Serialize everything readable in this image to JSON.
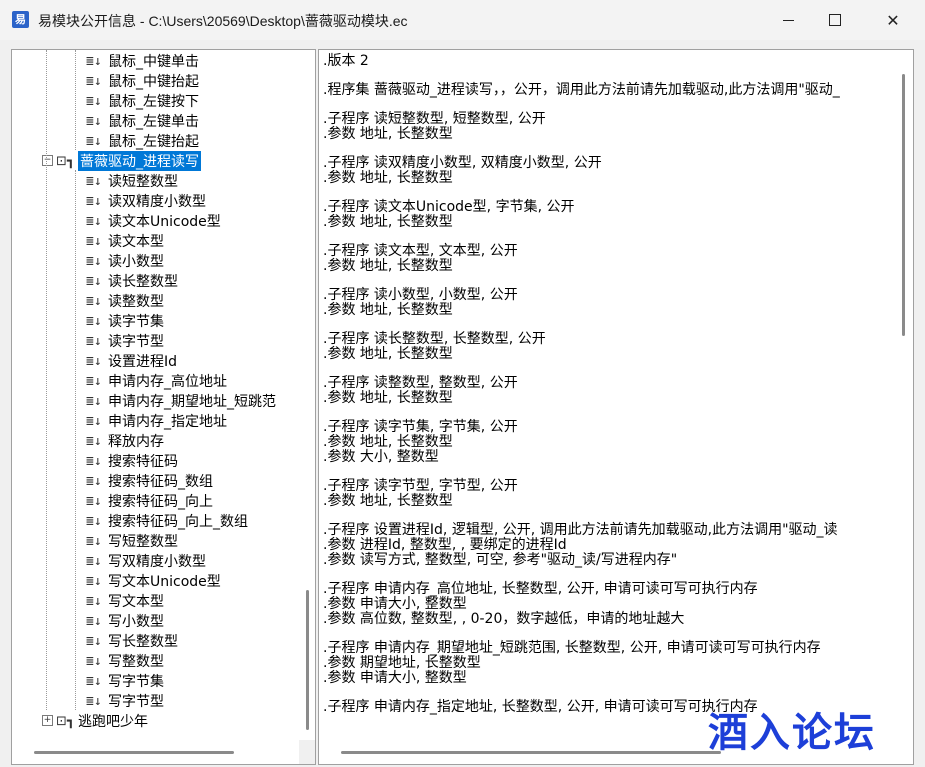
{
  "window": {
    "title": "易模块公开信息 - C:\\Users\\20569\\Desktop\\蔷薇驱动模块.ec",
    "app_icon_text": "易",
    "controls": {
      "minimize": "minimize-icon",
      "maximize": "maximize-icon",
      "close": "✕"
    }
  },
  "tree": {
    "items": [
      {
        "label": "鼠标_中键单击",
        "level": 2
      },
      {
        "label": "鼠标_中键抬起",
        "level": 2
      },
      {
        "label": "鼠标_左键按下",
        "level": 2
      },
      {
        "label": "鼠标_左键单击",
        "level": 2
      },
      {
        "label": "鼠标_左键抬起",
        "level": 2
      },
      {
        "label": "蔷薇驱动_进程读写",
        "level": 1,
        "expander": "−",
        "selected": true
      },
      {
        "label": "读短整数型",
        "level": 2
      },
      {
        "label": "读双精度小数型",
        "level": 2
      },
      {
        "label": "读文本Unicode型",
        "level": 2
      },
      {
        "label": "读文本型",
        "level": 2
      },
      {
        "label": "读小数型",
        "level": 2
      },
      {
        "label": "读长整数型",
        "level": 2
      },
      {
        "label": "读整数型",
        "level": 2
      },
      {
        "label": "读字节集",
        "level": 2
      },
      {
        "label": "读字节型",
        "level": 2
      },
      {
        "label": "设置进程Id",
        "level": 2
      },
      {
        "label": "申请内存_高位地址",
        "level": 2
      },
      {
        "label": "申请内存_期望地址_短跳范",
        "level": 2
      },
      {
        "label": "申请内存_指定地址",
        "level": 2
      },
      {
        "label": "释放内存",
        "level": 2
      },
      {
        "label": "搜索特征码",
        "level": 2
      },
      {
        "label": "搜索特征码_数组",
        "level": 2
      },
      {
        "label": "搜索特征码_向上",
        "level": 2
      },
      {
        "label": "搜索特征码_向上_数组",
        "level": 2
      },
      {
        "label": "写短整数型",
        "level": 2
      },
      {
        "label": "写双精度小数型",
        "level": 2
      },
      {
        "label": "写文本Unicode型",
        "level": 2
      },
      {
        "label": "写文本型",
        "level": 2
      },
      {
        "label": "写小数型",
        "level": 2
      },
      {
        "label": "写长整数型",
        "level": 2
      },
      {
        "label": "写整数型",
        "level": 2
      },
      {
        "label": "写字节集",
        "level": 2
      },
      {
        "label": "写字节型",
        "level": 2
      },
      {
        "label": "逃跑吧少年",
        "level": 1,
        "expander": "+"
      }
    ]
  },
  "text": {
    "lines": [
      ".版本 2",
      "",
      ".程序集 蔷薇驱动_进程读写，，公开，调用此方法前请先加载驱动,此方法调用\"驱动_",
      "",
      ".子程序 读短整数型, 短整数型, 公开",
      ".参数 地址, 长整数型",
      "",
      ".子程序 读双精度小数型, 双精度小数型, 公开",
      ".参数 地址, 长整数型",
      "",
      ".子程序 读文本Unicode型, 字节集, 公开",
      ".参数 地址, 长整数型",
      "",
      ".子程序 读文本型, 文本型, 公开",
      ".参数 地址, 长整数型",
      "",
      ".子程序 读小数型, 小数型, 公开",
      ".参数 地址, 长整数型",
      "",
      ".子程序 读长整数型, 长整数型, 公开",
      ".参数 地址, 长整数型",
      "",
      ".子程序 读整数型, 整数型, 公开",
      ".参数 地址, 长整数型",
      "",
      ".子程序 读字节集, 字节集, 公开",
      ".参数 地址, 长整数型",
      ".参数 大小, 整数型",
      "",
      ".子程序 读字节型, 字节型, 公开",
      ".参数 地址, 长整数型",
      "",
      ".子程序 设置进程Id, 逻辑型, 公开, 调用此方法前请先加载驱动,此方法调用\"驱动_读",
      ".参数 进程Id, 整数型, , 要绑定的进程Id",
      ".参数 读写方式, 整数型, 可空, 参考\"驱动_读/写进程内存\"",
      "",
      ".子程序 申请内存_高位地址, 长整数型, 公开, 申请可读可写可执行内存",
      ".参数 申请大小, 整数型",
      ".参数 高位数, 整数型, , 0-20，数字越低，申请的地址越大",
      "",
      ".子程序 申请内存_期望地址_短跳范围, 长整数型, 公开, 申请可读可写可执行内存",
      ".参数 期望地址, 长整数型",
      ".参数 申请大小, 整数型",
      "",
      ".子程序 申请内存_指定地址, 长整数型, 公开, 申请可读可写可执行内存"
    ]
  },
  "watermark": "酒入论坛"
}
